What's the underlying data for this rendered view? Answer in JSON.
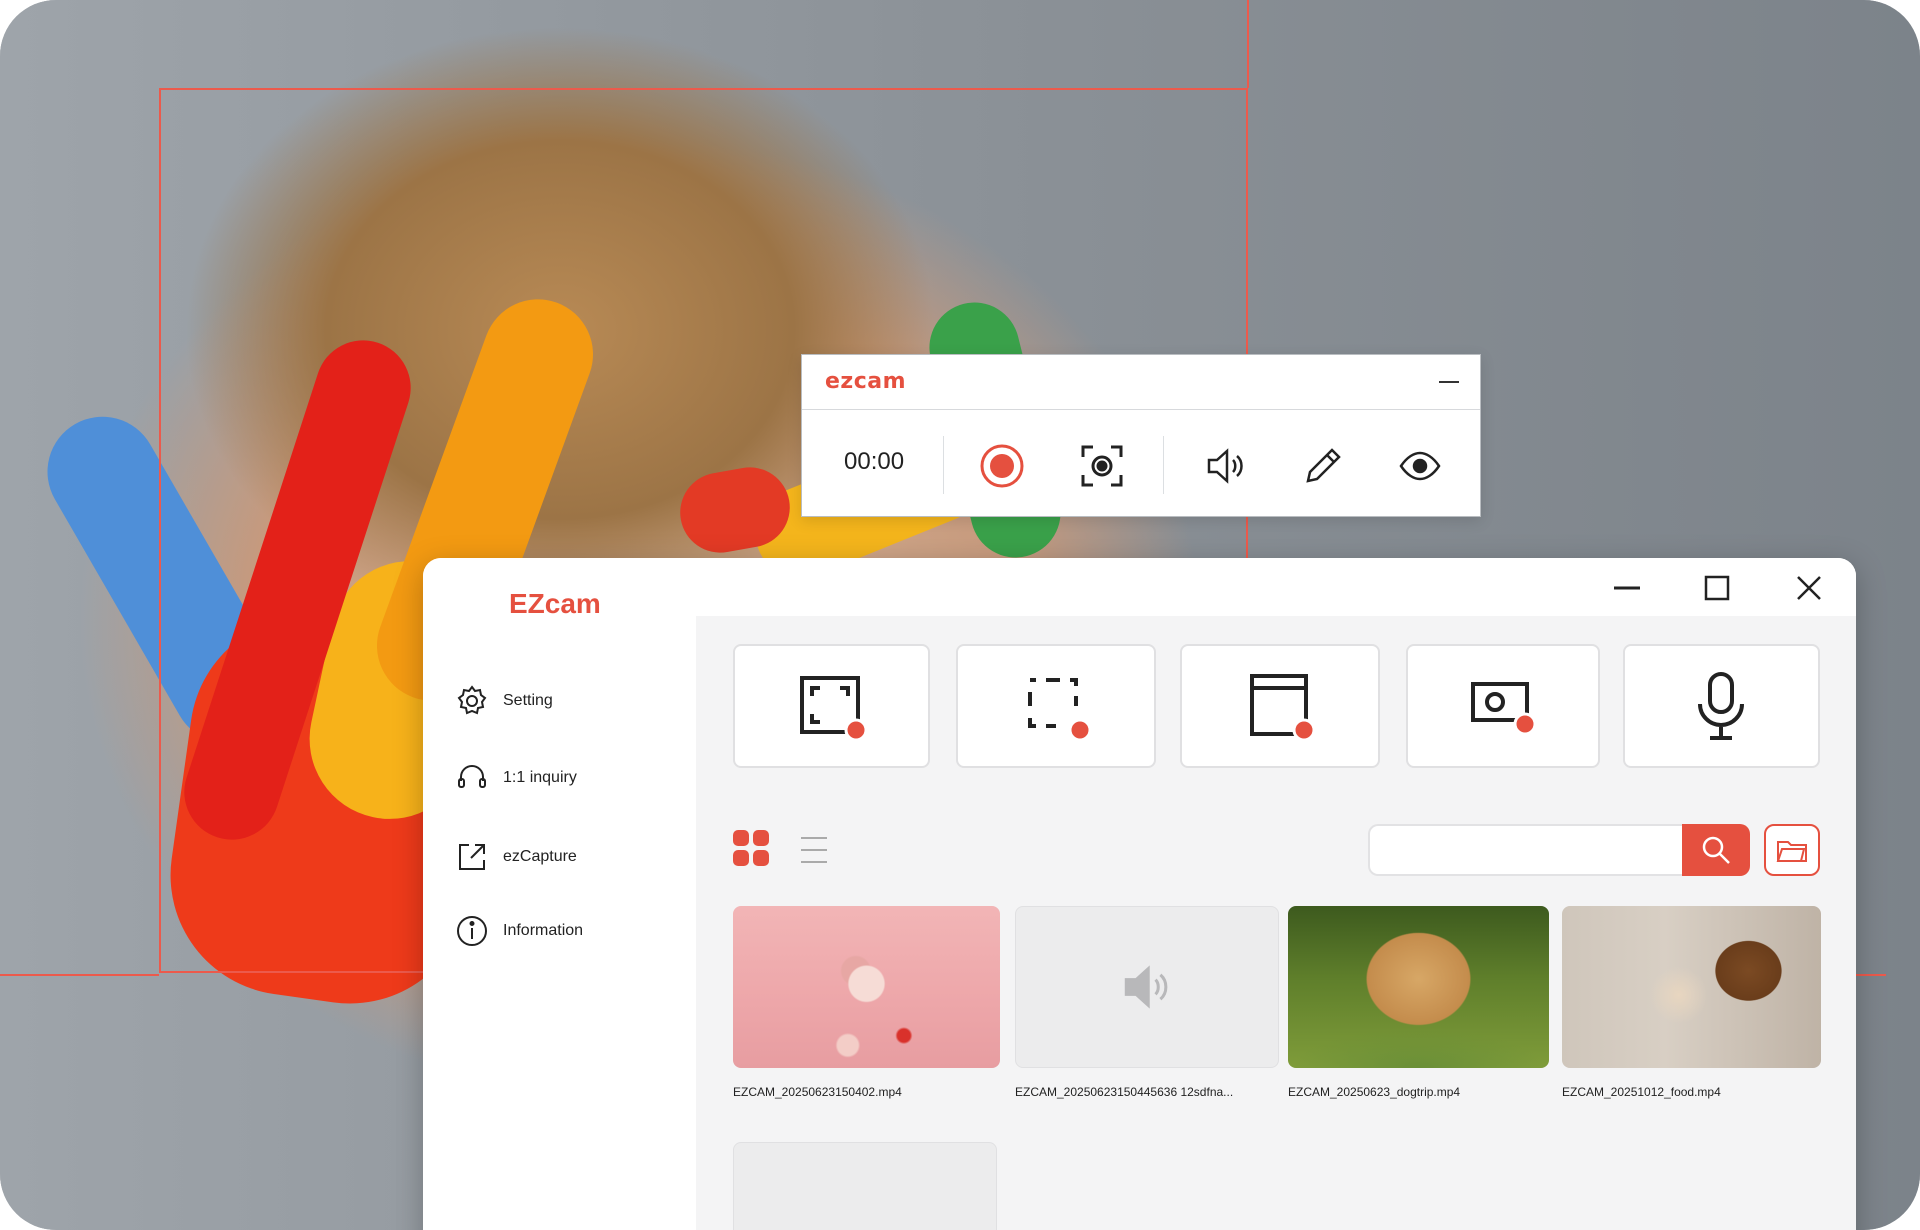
{
  "recorder_bar": {
    "logo": "ezcam",
    "timer": "00:00",
    "icons": [
      "record-icon",
      "screenshot-icon",
      "speaker-icon",
      "pencil-icon",
      "eye-icon"
    ]
  },
  "app": {
    "brand": "EZcam",
    "accent_color": "#e5503f",
    "sidebar": {
      "items": [
        {
          "label": "Setting",
          "icon": "gear-icon"
        },
        {
          "label": "1:1 inquiry",
          "icon": "headset-icon"
        },
        {
          "label": "ezCapture",
          "icon": "external-link-icon"
        },
        {
          "label": "Information",
          "icon": "info-icon"
        }
      ]
    },
    "window_controls": [
      "minimize-icon",
      "maximize-icon",
      "close-icon"
    ],
    "tools": [
      {
        "name": "fullscreen-record",
        "icon": "fullscreen-record-icon"
      },
      {
        "name": "region-record",
        "icon": "region-record-icon"
      },
      {
        "name": "window-record",
        "icon": "window-record-icon"
      },
      {
        "name": "webcam-record",
        "icon": "webcam-record-icon"
      },
      {
        "name": "audio-record",
        "icon": "microphone-icon"
      }
    ],
    "view_modes": {
      "active": "grid"
    },
    "search": {
      "placeholder": "",
      "value": ""
    },
    "files": [
      {
        "name": "EZCAM_20250623150402.mp4",
        "type": "video"
      },
      {
        "name": "EZCAM_20250623150445636 12sdfna...",
        "type": "audio"
      },
      {
        "name": "EZCAM_20250623_dogtrip.mp4",
        "type": "video"
      },
      {
        "name": "EZCAM_20251012_food.mp4",
        "type": "video"
      }
    ]
  }
}
